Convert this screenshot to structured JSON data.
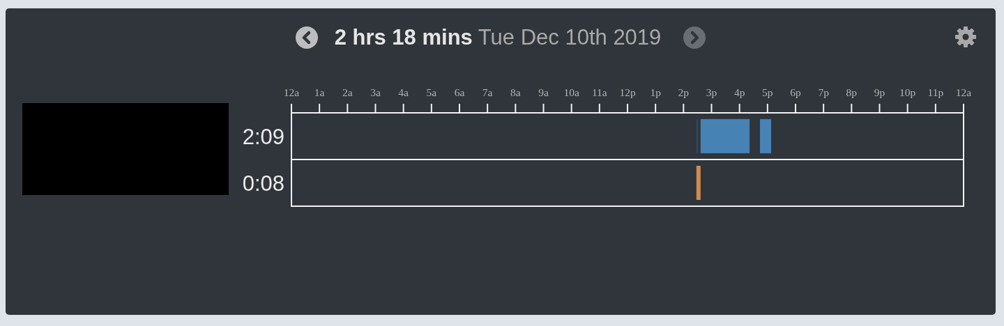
{
  "header": {
    "prev": {
      "disabled": false
    },
    "duration": "2 hrs 18 mins",
    "date": "Tue Dec 10th 2019",
    "next": {
      "disabled": true
    }
  },
  "timeline": {
    "axis_labels": [
      "12a",
      "1a",
      "2a",
      "3a",
      "4a",
      "5a",
      "6a",
      "7a",
      "8a",
      "9a",
      "10a",
      "11a",
      "12p",
      "1p",
      "2p",
      "3p",
      "4p",
      "5p",
      "6p",
      "7p",
      "8p",
      "9p",
      "10p",
      "11p",
      "12a"
    ],
    "rows": [
      {
        "total": "2:09",
        "segments": [
          {
            "color": "#2b4c6b"
          },
          {
            "color": "#4682b4"
          },
          {
            "color": "#4682b4"
          }
        ]
      },
      {
        "total": "0:08",
        "segments": [
          {
            "color": "#d08c4c"
          }
        ]
      }
    ]
  }
}
